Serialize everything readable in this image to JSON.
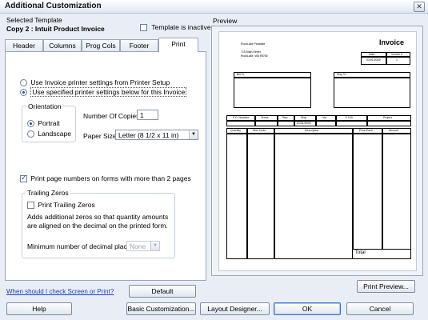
{
  "window": {
    "title": "Additional Customization",
    "close_glyph": "✕"
  },
  "template": {
    "label": "Selected Template",
    "name": "Copy 2 : Intuit Product Invoice",
    "inactive_label": "Template is inactive"
  },
  "tabs": [
    {
      "label": "Header"
    },
    {
      "label": "Columns"
    },
    {
      "label": "Prog Cols"
    },
    {
      "label": "Footer"
    },
    {
      "label": "Print",
      "active": true
    }
  ],
  "print": {
    "radio_printer_setup": "Use Invoice printer settings from Printer Setup",
    "radio_specified": "Use specified printer settings below for this Invoice",
    "orientation_label": "Orientation",
    "portrait_label": "Portrait",
    "landscape_label": "Landscape",
    "copies_label": "Number Of Copies",
    "copies_value": "1",
    "paper_size_label": "Paper Size",
    "paper_size_value": "Letter (8 1/2 x 11 in)",
    "page_numbers_label": "Print page numbers on forms with more than 2 pages",
    "trailing_zeros_group": "Trailing Zeros",
    "trailing_zeros_label": "Print Trailing Zeros",
    "trailing_zeros_desc": "Adds additional zeros so that quantity amounts are aligned on the decimal on the printed form.",
    "decimal_places_label": "Minimum number of decimal places:",
    "decimal_places_value": "None"
  },
  "bottom_left": {
    "help_link": "When should I check Screen or Print?",
    "default_button": "Default"
  },
  "preview": {
    "label": "Preview",
    "print_preview_button": "Print Preview...",
    "invoice": {
      "title": "Invoice",
      "company_lines": [
        "RockLake Paradise",
        "715 Main Street",
        "RockLake, WA 98765"
      ],
      "date_header": "Date",
      "invoice_no_header": "Invoice #",
      "date_value": "01/01/2009",
      "invoice_no_value": "1",
      "bill_to": "Bill To",
      "ship_to": "Ship To",
      "row1_headers": [
        "P.O. Number",
        "Terms",
        "Rep",
        "Ship",
        "Via",
        "F.O.B.",
        "Project"
      ],
      "ship_date": "01/01/2009",
      "row2_headers": [
        "Quantity",
        "Item Code",
        "Description",
        "Price Each",
        "Amount"
      ],
      "total_label": "Total"
    }
  },
  "footer_buttons": {
    "help": "Help",
    "basic": "Basic Customization...",
    "layout": "Layout Designer...",
    "ok": "OK",
    "cancel": "Cancel"
  }
}
